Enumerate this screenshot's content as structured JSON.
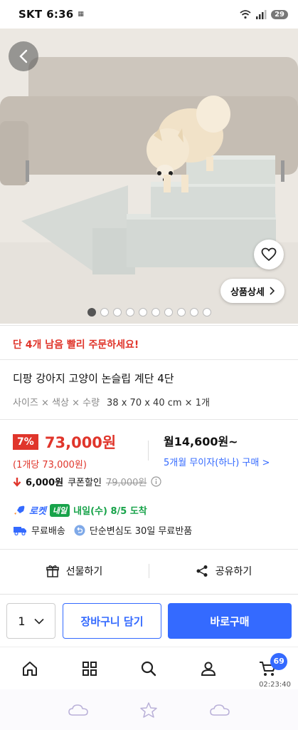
{
  "status_bar": {
    "carrier": "SKT",
    "time": "6:36",
    "battery": "29"
  },
  "hero": {
    "detail_label": "상품상세",
    "dots_total": 10,
    "dots_active": 1
  },
  "urgency": "단 4개 남음 빨리 주문하세요!",
  "product": {
    "title": "디팡 강아지 고양이 논슬립 계단 4단",
    "option_label": "사이즈 × 색상 × 수량",
    "option_value": "38 x 70 x 40 cm × 1개"
  },
  "price": {
    "discount": "7%",
    "sale_price": "73,000원",
    "unit_price": "(1개당 73,000원)",
    "monthly": "월14,600원~",
    "installment": "5개월 무이자(하나) 구매 >"
  },
  "coupon": {
    "amount": "6,000원",
    "label": "쿠폰할인",
    "original": "79,000원"
  },
  "delivery": {
    "rocket": "로켓",
    "rocket_badge": "내일",
    "eta": "내일(수) 8/5 도착",
    "free_shipping": "무료배송",
    "free_return": "단순변심도 30일 무료반품"
  },
  "share": {
    "gift": "선물하기",
    "share": "공유하기"
  },
  "action": {
    "qty": "1",
    "cart": "장바구니 담기",
    "buy": "바로구매"
  },
  "nav": {
    "cart_count": "69",
    "timer": "02:23:40"
  },
  "colors": {
    "accent": "#346aff",
    "sale_red": "#e0352b",
    "rocket_green": "#18a34a"
  }
}
